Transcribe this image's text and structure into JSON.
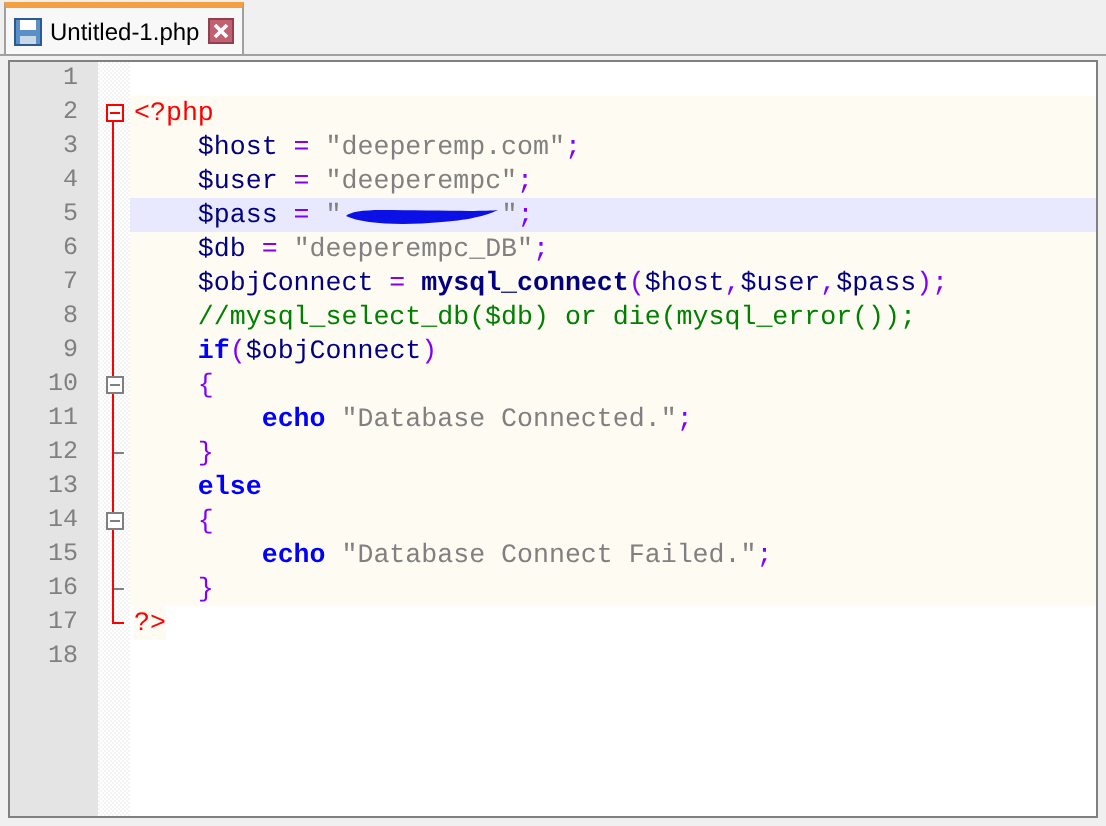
{
  "tabs": [
    {
      "label": "Untitled-1.php",
      "selected": true
    }
  ],
  "lines": [
    {
      "number": "1",
      "kind": "plain",
      "php_background": false
    },
    {
      "number": "2",
      "kind": "open",
      "php_background": true,
      "tokens": [
        {
          "kind": "tag",
          "text": "<?php"
        }
      ]
    },
    {
      "number": "3",
      "kind": "body",
      "php_background": true,
      "tokens": [
        {
          "kind": "var",
          "text": "    $host"
        },
        {
          "kind": "op",
          "text": " = "
        },
        {
          "kind": "str",
          "text": "\"deeperemp.com\""
        },
        {
          "kind": "op",
          "text": ";"
        }
      ]
    },
    {
      "number": "4",
      "kind": "body",
      "php_background": true,
      "tokens": [
        {
          "kind": "var",
          "text": "    $user"
        },
        {
          "kind": "op",
          "text": " = "
        },
        {
          "kind": "str",
          "text": "\"deeperempc\""
        },
        {
          "kind": "op",
          "text": ";"
        }
      ]
    },
    {
      "number": "5",
      "kind": "body",
      "current": true,
      "tokens": [
        {
          "kind": "var",
          "text": "    $pass"
        },
        {
          "kind": "op",
          "text": " = "
        },
        {
          "kind": "str",
          "text": "\""
        },
        {
          "kind": "redacted"
        },
        {
          "kind": "str",
          "text": "\""
        },
        {
          "kind": "op",
          "text": ";"
        }
      ]
    },
    {
      "number": "6",
      "kind": "body",
      "php_background": true,
      "tokens": [
        {
          "kind": "var",
          "text": "    $db"
        },
        {
          "kind": "op",
          "text": " = "
        },
        {
          "kind": "str",
          "text": "\"deeperempc_DB\""
        },
        {
          "kind": "op",
          "text": ";"
        }
      ]
    },
    {
      "number": "7",
      "kind": "body",
      "php_background": true,
      "tokens": [
        {
          "kind": "var",
          "text": "    $objConnect"
        },
        {
          "kind": "op",
          "text": " = "
        },
        {
          "kind": "func",
          "text": "mysql_connect"
        },
        {
          "kind": "op",
          "text": "("
        },
        {
          "kind": "var",
          "text": "$host"
        },
        {
          "kind": "op",
          "text": ","
        },
        {
          "kind": "var",
          "text": "$user"
        },
        {
          "kind": "op",
          "text": ","
        },
        {
          "kind": "var",
          "text": "$pass"
        },
        {
          "kind": "op",
          "text": ");"
        }
      ]
    },
    {
      "number": "8",
      "kind": "body",
      "php_background": true,
      "tokens": [
        {
          "kind": "comment",
          "text": "    //mysql_select_db($db) or die(mysql_error());"
        }
      ]
    },
    {
      "number": "9",
      "kind": "body",
      "php_background": true,
      "tokens": [
        {
          "kind": "kw",
          "text": "    if"
        },
        {
          "kind": "op",
          "text": "("
        },
        {
          "kind": "var",
          "text": "$objConnect"
        },
        {
          "kind": "op",
          "text": ")"
        }
      ]
    },
    {
      "number": "10",
      "kind": "subopen",
      "php_background": true,
      "tokens": [
        {
          "kind": "op",
          "text": "    {"
        }
      ]
    },
    {
      "number": "11",
      "kind": "body",
      "php_background": true,
      "tokens": [
        {
          "kind": "kw",
          "text": "        echo"
        },
        {
          "kind": "str",
          "text": " \"Database Connected.\""
        },
        {
          "kind": "op",
          "text": ";"
        }
      ]
    },
    {
      "number": "12",
      "kind": "subend",
      "php_background": true,
      "tokens": [
        {
          "kind": "op",
          "text": "    }"
        }
      ]
    },
    {
      "number": "13",
      "kind": "body",
      "php_background": true,
      "tokens": [
        {
          "kind": "kw",
          "text": "    else"
        }
      ]
    },
    {
      "number": "14",
      "kind": "subopen",
      "php_background": true,
      "tokens": [
        {
          "kind": "op",
          "text": "    {"
        }
      ]
    },
    {
      "number": "15",
      "kind": "body",
      "php_background": true,
      "tokens": [
        {
          "kind": "kw",
          "text": "        echo"
        },
        {
          "kind": "str",
          "text": " \"Database Connect Failed.\""
        },
        {
          "kind": "op",
          "text": ";"
        }
      ]
    },
    {
      "number": "16",
      "kind": "subend",
      "php_background": true,
      "tokens": [
        {
          "kind": "op",
          "text": "    }"
        }
      ]
    },
    {
      "number": "17",
      "kind": "end",
      "php_background": false,
      "tokens": [
        {
          "kind": "tag",
          "text": "?>"
        }
      ]
    },
    {
      "number": "18",
      "kind": "plain",
      "php_background": false
    }
  ]
}
